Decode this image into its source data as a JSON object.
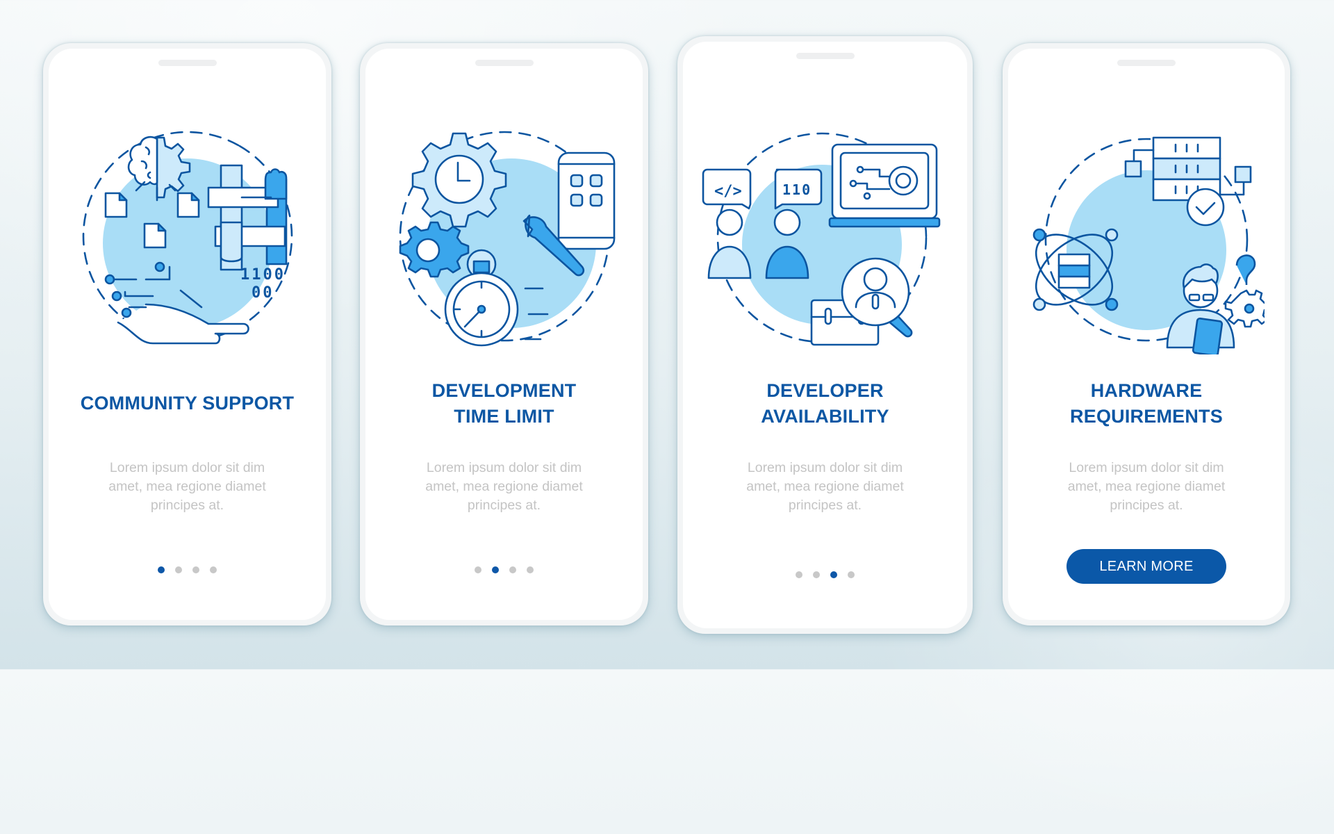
{
  "theme": {
    "accent": "#0d57a4",
    "button_bg": "#0b58a8",
    "dot_active": "#0d57a8",
    "dot_inactive": "#c8c8c8",
    "body_text": "#c4c4c4",
    "illustration_fill": "#a9ddf6",
    "illustration_stroke": "#0c55a0"
  },
  "screens": [
    {
      "illustration": "community-support-illustration",
      "icons": [
        "brain-gear-icon",
        "document-icon",
        "joined-hands-icon",
        "robotic-hand-icon"
      ],
      "binary_text_1": "1100",
      "binary_text_2": "00",
      "title_lines": [
        "COMMUNITY SUPPORT"
      ],
      "description_lines": [
        "Lorem ipsum dolor sit dim",
        "amet, mea regione diamet",
        "principes at."
      ],
      "pagination": {
        "total": 4,
        "active": 1
      }
    },
    {
      "illustration": "development-time-limit-illustration",
      "icons": [
        "gear-clock-icon",
        "gear-icon",
        "smartphone-apps-icon",
        "wrench-icon",
        "stopwatch-icon"
      ],
      "title_lines": [
        "DEVELOPMENT",
        "TIME LIMIT"
      ],
      "description_lines": [
        "Lorem ipsum dolor sit dim",
        "amet, mea regione diamet",
        "principes at."
      ],
      "pagination": {
        "total": 4,
        "active": 2
      }
    },
    {
      "illustration": "developer-availability-illustration",
      "icons": [
        "code-bubble-icon",
        "binary-bubble-icon",
        "person-icon",
        "laptop-gear-icon",
        "magnifier-person-icon",
        "briefcase-icon"
      ],
      "code_bubble_text": "</>",
      "binary_bubble_text": "110",
      "title_lines": [
        "DEVELOPER",
        "AVAILABILITY"
      ],
      "description_lines": [
        "Lorem ipsum dolor sit dim",
        "amet, mea regione diamet",
        "principes at."
      ],
      "pagination": {
        "total": 4,
        "active": 3
      }
    },
    {
      "illustration": "hardware-requirements-illustration",
      "icons": [
        "server-rack-icon",
        "checkmark-circle-icon",
        "atom-database-icon",
        "developer-tablet-icon",
        "question-gear-icon"
      ],
      "title_lines": [
        "HARDWARE",
        "REQUIREMENTS"
      ],
      "description_lines": [
        "Lorem ipsum dolor sit dim",
        "amet, mea regione diamet",
        "principes at."
      ],
      "button_label": "LEARN MORE"
    }
  ]
}
